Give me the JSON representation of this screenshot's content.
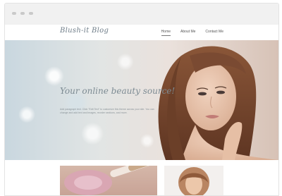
{
  "site": {
    "logo": "Blush-it Blog",
    "nav": [
      {
        "label": "Home",
        "active": true
      },
      {
        "label": "About Me",
        "active": false
      },
      {
        "label": "Contact Me",
        "active": false
      }
    ]
  },
  "hero": {
    "title": "Your online beauty source!",
    "body": "Add paragraph text. Click \"Edit Text\" to customize this theme across your site. You can change and add text and images, reorder sections, and more."
  },
  "colors": {
    "accent_text": "#7d8b93",
    "hair": "#7a4a32",
    "skin": "#e8c4aa"
  }
}
